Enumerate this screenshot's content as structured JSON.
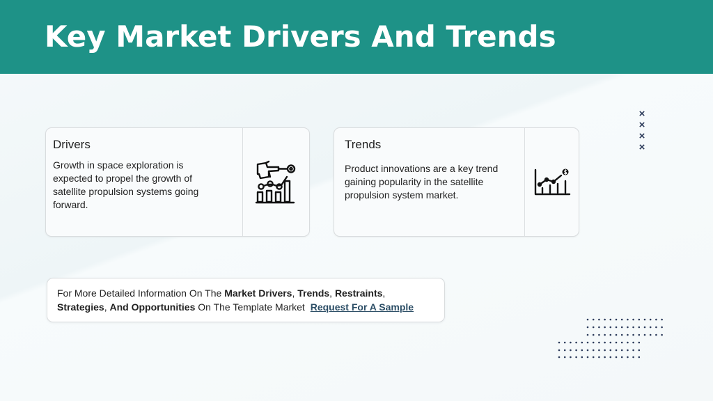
{
  "header": {
    "title": "Key Market Drivers And Trends"
  },
  "drivers": {
    "title": "Drivers",
    "body": "Growth in space exploration is expected to propel the growth of satellite propulsion systems going forward.",
    "icon": "presentation-chart-icon"
  },
  "trends": {
    "title": "Trends",
    "body": "Product innovations are a key trend gaining popularity in the satellite propulsion system market.",
    "icon": "growth-chart-icon"
  },
  "decor": {
    "x_marks": [
      "×",
      "×",
      "×",
      "×"
    ]
  },
  "info": {
    "t1": "For More Detailed Information On The ",
    "b1": "Market Drivers",
    "t2": ", ",
    "b2": "Trends",
    "t3": ", ",
    "b3": "Restraints",
    "t4": ", ",
    "b4": "Strategies",
    "t5": ", ",
    "b5": "And Opportunities",
    "t6": " On The Template Market ",
    "link": "Request For A Sample"
  },
  "colors": {
    "header_bg": "#1e9287",
    "link": "#2c4e66",
    "accent_dark": "#2b3a5a"
  }
}
